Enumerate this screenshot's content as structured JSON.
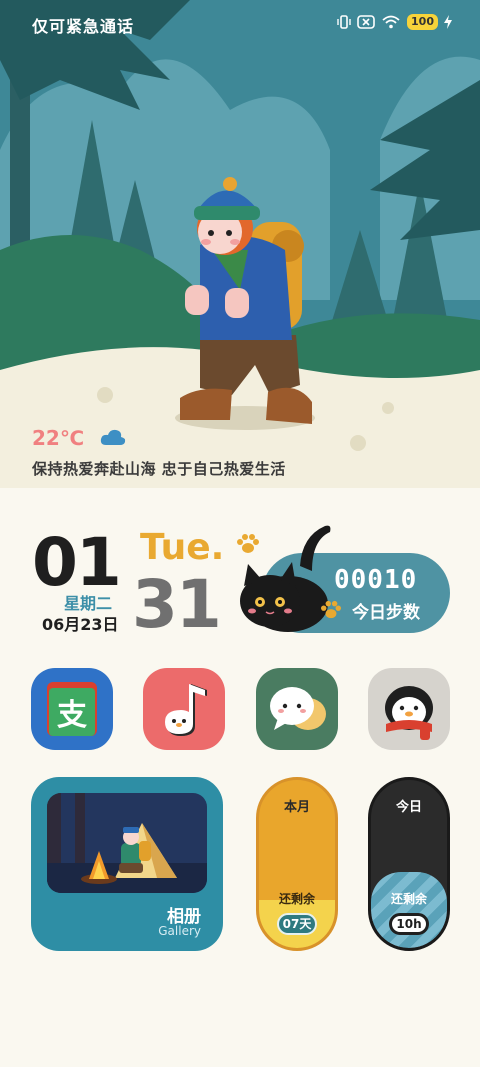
{
  "status_bar": {
    "carrier_text": "仅可紧急通话",
    "battery": "100",
    "icons": [
      "vibrate-icon",
      "no-sim-icon",
      "wifi-icon",
      "battery-icon",
      "charging-icon"
    ]
  },
  "weather": {
    "temperature": "22℃",
    "icon": "cloud-icon",
    "motto": "保持热爱奔赴山海 忠于自己热爱生活"
  },
  "clock": {
    "hour": "01",
    "weekday_cn": "星期二",
    "date_cn": "06月23日",
    "weekday_en": "Tue.",
    "minute": "31"
  },
  "steps": {
    "count": "00010",
    "label": "今日步数"
  },
  "apps": [
    {
      "name": "alipay",
      "icon": "alipay-icon",
      "bg": "#2f72c7"
    },
    {
      "name": "music",
      "icon": "music-note-icon",
      "bg": "#ec6b6b"
    },
    {
      "name": "chat",
      "icon": "chat-bubbles-icon",
      "bg": "#4a7c61"
    },
    {
      "name": "penguin",
      "icon": "penguin-icon",
      "bg": "#d6d3cd"
    }
  ],
  "gallery": {
    "title": "相册",
    "subtitle": "Gallery"
  },
  "month_remaining": {
    "title": "本月",
    "label": "还剩余",
    "value": "07天"
  },
  "day_remaining": {
    "title": "今日",
    "label": "还剩余",
    "value": "10h"
  },
  "colors": {
    "accent_teal": "#4f93a3",
    "accent_orange": "#e9a931",
    "temp_pink": "#f08080"
  }
}
